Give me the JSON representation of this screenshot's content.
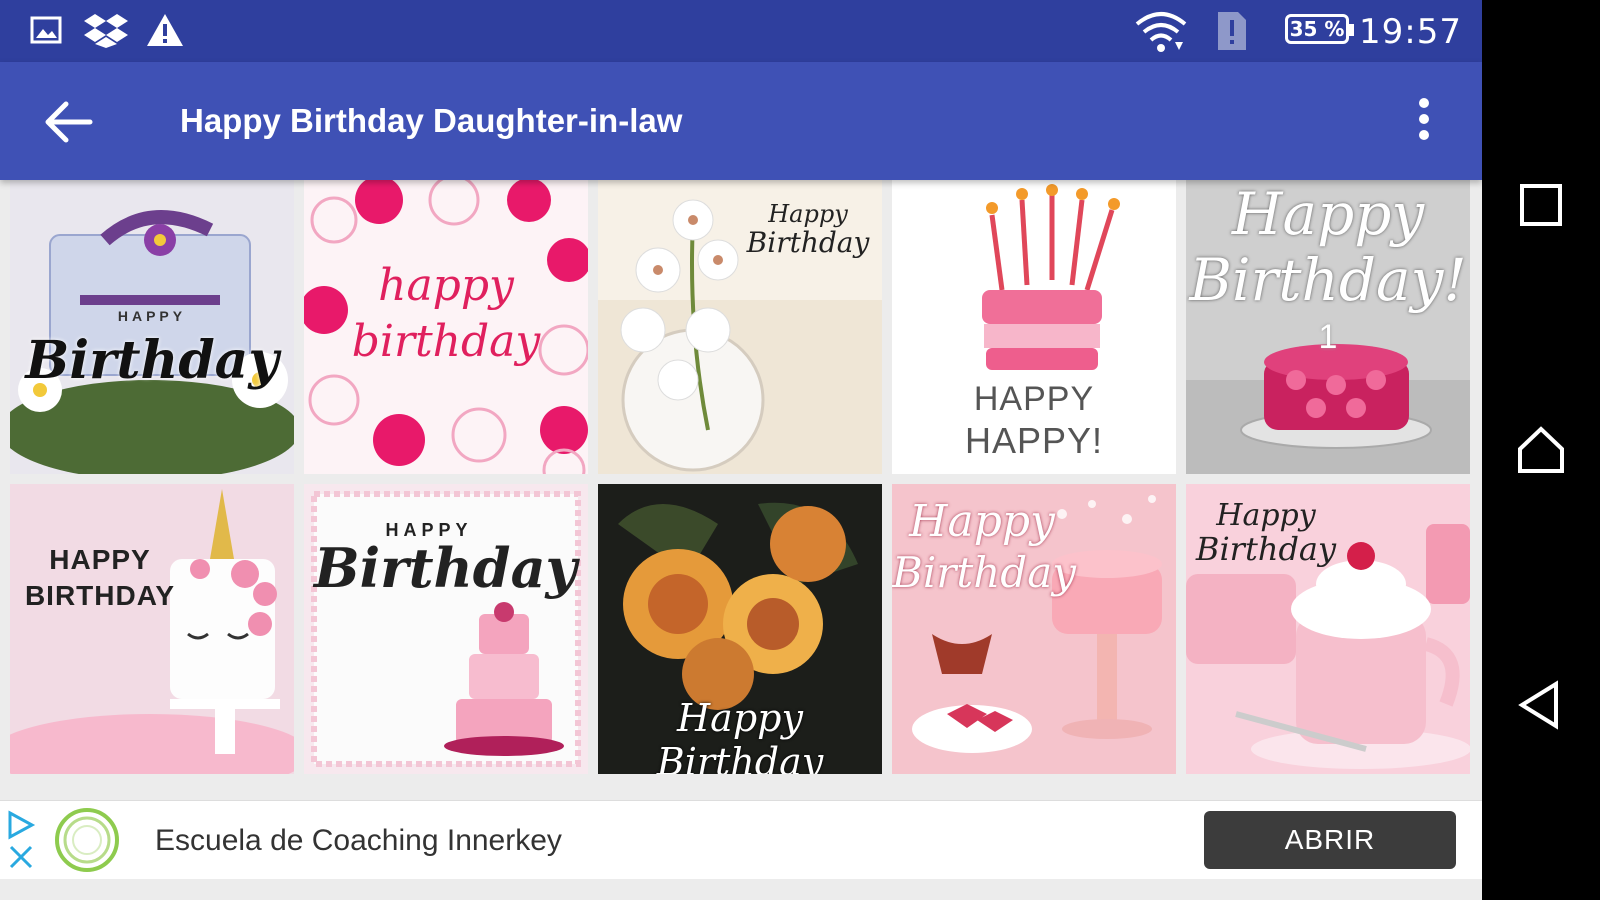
{
  "status_bar": {
    "time": "19:57",
    "battery": "35 %",
    "icons": [
      "image-icon",
      "dropbox-icon",
      "warning-icon",
      "wifi-icon",
      "sim-alert-icon",
      "battery-icon"
    ]
  },
  "app_bar": {
    "title": "Happy Birthday Daughter-in-law",
    "back_icon": "arrow-back-icon",
    "menu_icon": "more-vert-icon",
    "color": "#3f51b5"
  },
  "cards": [
    {
      "name": "card-gift-birthday",
      "lines": [
        "HAPPY",
        "Birthday"
      ]
    },
    {
      "name": "card-pink-flowers",
      "lines": [
        "happy",
        "birthday"
      ]
    },
    {
      "name": "card-white-orchids",
      "lines": [
        "Happy",
        "Birthday"
      ]
    },
    {
      "name": "card-watercolor-cake",
      "lines": [
        "HAPPY",
        "HAPPY!"
      ]
    },
    {
      "name": "card-rose-cake",
      "lines": [
        "Happy",
        "Birthday!",
        "1"
      ]
    },
    {
      "name": "card-unicorn-cake",
      "lines": [
        "HAPPY",
        "BIRTHDAY"
      ]
    },
    {
      "name": "card-tiered-cake",
      "lines": [
        "HAPPY",
        "Birthday"
      ]
    },
    {
      "name": "card-orange-roses",
      "lines": [
        "Happy Birthday"
      ]
    },
    {
      "name": "card-pink-desserts",
      "lines": [
        "Happy",
        "Birthday"
      ]
    },
    {
      "name": "card-pink-cupcake",
      "lines": [
        "Happy",
        "Birthday"
      ]
    }
  ],
  "ad": {
    "advertiser": "Escuela de Coaching Innerkey",
    "button_label": "ABRIR"
  },
  "nav_bar": {
    "icons": [
      "recents-icon",
      "home-icon",
      "back-icon"
    ]
  }
}
